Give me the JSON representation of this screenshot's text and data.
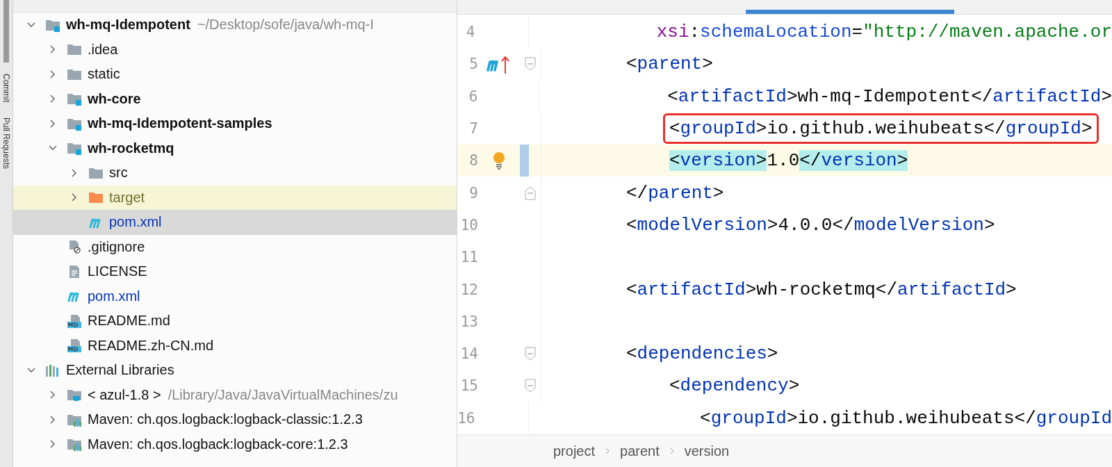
{
  "tool_strip": [
    {
      "label": "Commit",
      "selected": false
    },
    {
      "label": "Pull Requests",
      "selected": false
    }
  ],
  "project_tree": [
    {
      "kind": "module",
      "name": "wh-mq-Idempotent",
      "path": "~/Desktop/sofe/java/wh-mq-I",
      "expanded": true,
      "selected": false,
      "children": [
        {
          "kind": "folder",
          "name": ".idea",
          "expanded": false,
          "selected": false
        },
        {
          "kind": "folder",
          "name": "static",
          "expanded": false,
          "selected": false
        },
        {
          "kind": "module",
          "name": "wh-core",
          "expanded": false,
          "selected": false
        },
        {
          "kind": "module",
          "name": "wh-mq-Idempotent-samples",
          "expanded": false,
          "selected": false
        },
        {
          "kind": "module",
          "name": "wh-rocketmq",
          "expanded": true,
          "selected": false,
          "children": [
            {
              "kind": "folder",
              "name": "src",
              "expanded": false,
              "selected": false
            },
            {
              "kind": "excluded",
              "name": "target",
              "expanded": false,
              "selected": false
            },
            {
              "kind": "maven",
              "name": "pom.xml",
              "selected": true
            }
          ]
        },
        {
          "kind": "ignore",
          "name": ".gitignore",
          "selected": false
        },
        {
          "kind": "text",
          "name": "LICENSE",
          "selected": false
        },
        {
          "kind": "maven",
          "name": "pom.xml",
          "selected": false
        },
        {
          "kind": "markdown",
          "name": "README.md",
          "selected": false
        },
        {
          "kind": "markdown",
          "name": "README.zh-CN.md",
          "selected": false
        }
      ]
    },
    {
      "kind": "libraries",
      "name": "External Libraries",
      "expanded": true,
      "selected": false,
      "children": [
        {
          "kind": "sdk",
          "name": "< azul-1.8 >",
          "path": "/Library/Java/JavaVirtualMachines/zu",
          "expanded": false,
          "selected": false
        },
        {
          "kind": "library",
          "name": "Maven: ch.qos.logback:logback-classic:1.2.3",
          "expanded": false,
          "selected": false
        },
        {
          "kind": "library",
          "name": "Maven: ch.qos.logback:logback-core:1.2.3",
          "expanded": false,
          "selected": false
        }
      ]
    }
  ],
  "editor": {
    "lines": [
      {
        "number": "4",
        "continuation": true,
        "tokens": [
          {
            "kind": "attr",
            "text": "xsi"
          },
          {
            "kind": "punct",
            "text": ":"
          },
          {
            "kind": "attrname",
            "text": "schemaLocation"
          },
          {
            "kind": "punct",
            "text": "="
          },
          {
            "kind": "str",
            "text": "\"http://maven.apache.or"
          }
        ]
      },
      {
        "number": "5",
        "parent_marker": true,
        "fold_start": true,
        "tokens": [
          {
            "kind": "punct",
            "text": "<"
          },
          {
            "kind": "tag",
            "text": "parent"
          },
          {
            "kind": "punct",
            "text": ">"
          }
        ],
        "children": [
          {
            "number": "6",
            "tokens": [
              {
                "kind": "punct",
                "text": "<"
              },
              {
                "kind": "tag",
                "text": "artifactId"
              },
              {
                "kind": "punct",
                "text": ">wh-mq-Idempotent</"
              },
              {
                "kind": "tag",
                "text": "artifactId"
              },
              {
                "kind": "punct",
                "text": ">"
              }
            ]
          },
          {
            "number": "7",
            "boxed": true,
            "tokens": [
              {
                "kind": "punct",
                "text": "<"
              },
              {
                "kind": "tag",
                "text": "groupId"
              },
              {
                "kind": "punct",
                "text": ">io.github.weihubeats</"
              },
              {
                "kind": "tag",
                "text": "groupId"
              },
              {
                "kind": "punct",
                "text": ">"
              }
            ]
          },
          {
            "number": "8",
            "current": true,
            "bulb": true,
            "tokens": [
              {
                "kind": "punct",
                "text": "<",
                "match": true
              },
              {
                "kind": "tag",
                "text": "version",
                "match": true
              },
              {
                "kind": "punct",
                "text": ">",
                "match": true
              },
              {
                "kind": "punct",
                "text": "1.0"
              },
              {
                "kind": "punct",
                "text": "</",
                "match": true
              },
              {
                "kind": "tag",
                "text": "version",
                "match": true
              },
              {
                "kind": "punct",
                "text": ">",
                "match": true
              }
            ]
          }
        ]
      },
      {
        "number": "9",
        "fold_end": true,
        "tokens": [
          {
            "kind": "punct",
            "text": "</"
          },
          {
            "kind": "tag",
            "text": "parent"
          },
          {
            "kind": "punct",
            "text": ">"
          }
        ]
      },
      {
        "number": "10",
        "tokens": [
          {
            "kind": "punct",
            "text": "<"
          },
          {
            "kind": "tag",
            "text": "modelVersion"
          },
          {
            "kind": "punct",
            "text": ">4.0.0</"
          },
          {
            "kind": "tag",
            "text": "modelVersion"
          },
          {
            "kind": "punct",
            "text": ">"
          }
        ]
      },
      {
        "number": "11"
      },
      {
        "number": "12",
        "tokens": [
          {
            "kind": "punct",
            "text": "<"
          },
          {
            "kind": "tag",
            "text": "artifactId"
          },
          {
            "kind": "punct",
            "text": ">wh-rocketmq</"
          },
          {
            "kind": "tag",
            "text": "artifactId"
          },
          {
            "kind": "punct",
            "text": ">"
          }
        ]
      },
      {
        "number": "13"
      },
      {
        "number": "14",
        "fold_start": true,
        "tokens": [
          {
            "kind": "punct",
            "text": "<"
          },
          {
            "kind": "tag",
            "text": "dependencies"
          },
          {
            "kind": "punct",
            "text": ">"
          }
        ],
        "children": [
          {
            "number": "15",
            "fold_start": true,
            "tokens": [
              {
                "kind": "punct",
                "text": "<"
              },
              {
                "kind": "tag",
                "text": "dependency"
              },
              {
                "kind": "punct",
                "text": ">"
              }
            ],
            "children": [
              {
                "number": "16",
                "tokens": [
                  {
                    "kind": "punct",
                    "text": "<"
                  },
                  {
                    "kind": "tag",
                    "text": "groupId"
                  },
                  {
                    "kind": "punct",
                    "text": ">io.github.weihubeats</"
                  },
                  {
                    "kind": "tag",
                    "text": "groupId"
                  }
                ]
              }
            ]
          }
        ]
      }
    ]
  },
  "breadcrumbs": [
    {
      "label": "project"
    },
    {
      "label": "parent"
    },
    {
      "label": "version"
    }
  ]
}
